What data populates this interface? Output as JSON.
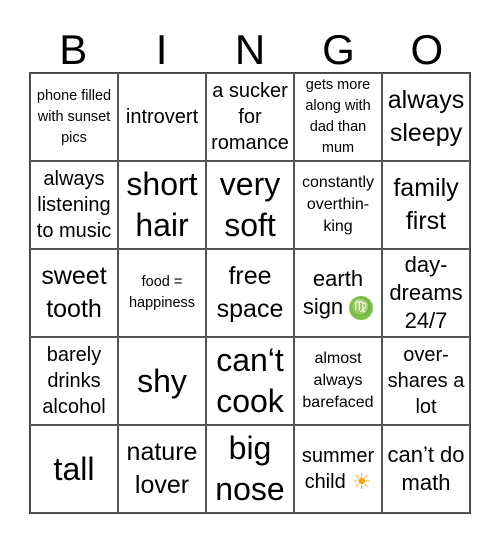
{
  "header": [
    "B",
    "I",
    "N",
    "G",
    "O"
  ],
  "cells": [
    {
      "text": "phone filled with sunset pics",
      "size": "s14"
    },
    {
      "text": "introvert",
      "size": "s19"
    },
    {
      "text": "a sucker for romance",
      "size": "s19"
    },
    {
      "text": "gets more along with dad than mum",
      "size": "s14"
    },
    {
      "text": "always sleepy",
      "size": "s26"
    },
    {
      "text": "always listening to music",
      "size": "s19"
    },
    {
      "text": "short hair",
      "size": "s32"
    },
    {
      "text": "very soft",
      "size": "s32"
    },
    {
      "text": "constantly overthin-king",
      "size": "s16"
    },
    {
      "text": "family first",
      "size": "s26"
    },
    {
      "text": "sweet tooth",
      "size": "s26"
    },
    {
      "text": "food = happiness",
      "size": "s14"
    },
    {
      "text": "free space",
      "size": "s26"
    },
    {
      "text": "earth sign",
      "size": "s22",
      "icon": "virgo-icon",
      "glyph": "♍"
    },
    {
      "text": "day-dreams 24/7",
      "size": "s22"
    },
    {
      "text": "barely drinks alcohol",
      "size": "s19"
    },
    {
      "text": "shy",
      "size": "s32"
    },
    {
      "text": "can‘t cook",
      "size": "s32"
    },
    {
      "text": "almost always barefaced",
      "size": "s16"
    },
    {
      "text": "over-shares a lot",
      "size": "s19"
    },
    {
      "text": "tall",
      "size": "s32"
    },
    {
      "text": "nature lover",
      "size": "s26"
    },
    {
      "text": "big nose",
      "size": "s32"
    },
    {
      "text": "summer child",
      "size": "s19",
      "icon": "sun-icon",
      "glyph": "☀"
    },
    {
      "text": "can’t do math",
      "size": "s22"
    }
  ]
}
